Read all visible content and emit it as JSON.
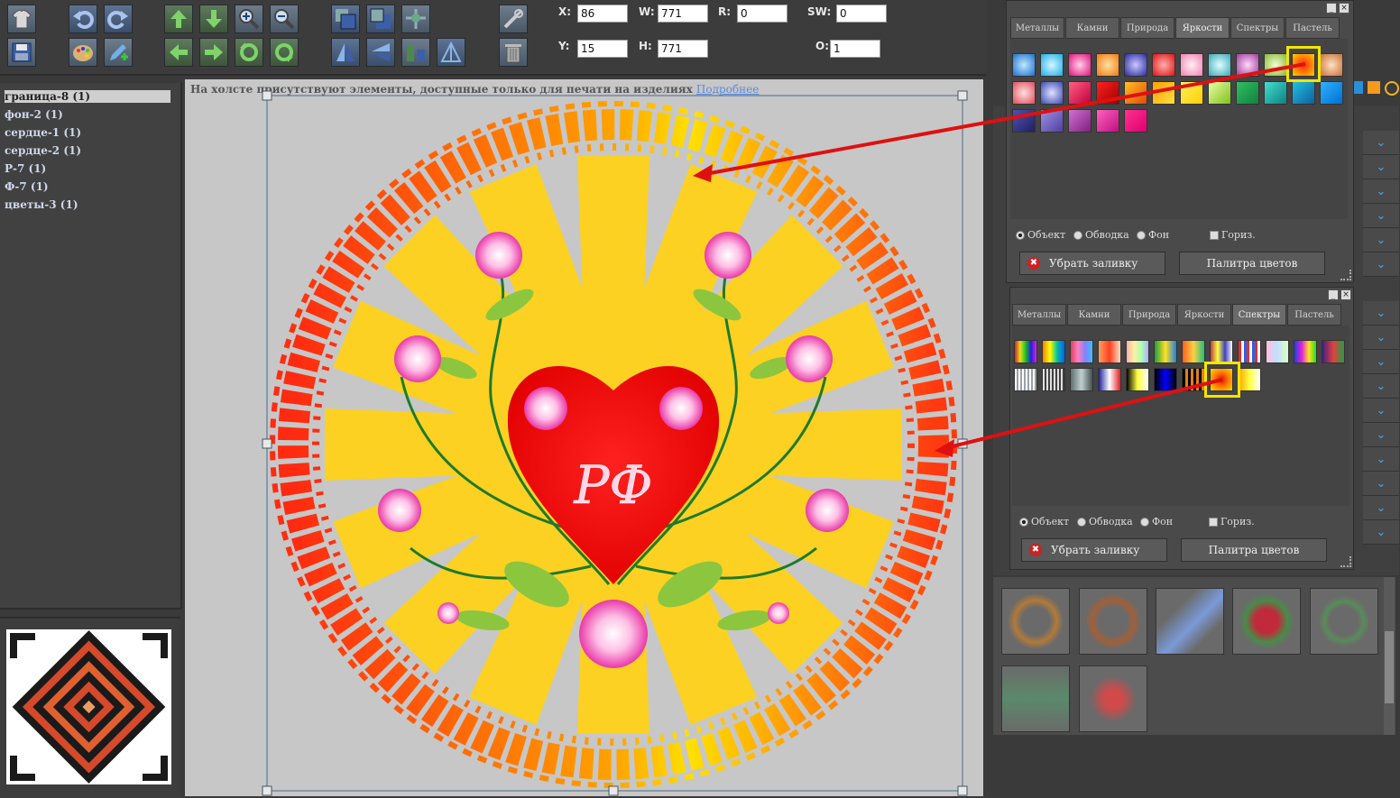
{
  "toolbar": {
    "coords": {
      "x_label": "X:",
      "x_value": "86",
      "y_label": "Y:",
      "y_value": "15",
      "w_label": "W:",
      "w_value": "771",
      "h_label": "H:",
      "h_value": "771",
      "r_label": "R:",
      "r_value": "0",
      "sw_label": "SW:",
      "sw_value": "0",
      "o_label": "O:",
      "o_value": "1"
    },
    "icons": [
      "tshirt-icon",
      "save-icon",
      "undo-icon",
      "redo-icon",
      "palette-icon",
      "edit-add-icon",
      "move-up-icon",
      "move-down-icon",
      "zoom-in-icon",
      "zoom-out-icon",
      "move-left-icon",
      "move-right-icon",
      "rotate-left-icon",
      "rotate-right-icon",
      "bring-front-icon",
      "send-back-icon",
      "group-icon",
      "flip-horizontal-icon",
      "flip-vertical-icon",
      "align-icon",
      "align-bottom-icon",
      "tools-icon",
      "trash-icon"
    ]
  },
  "layers": [
    {
      "label": "граница-8 (1)",
      "active": true
    },
    {
      "label": "фон-2 (1)"
    },
    {
      "label": "сердце-1 (1)"
    },
    {
      "label": "сердце-2 (1)"
    },
    {
      "label": "Р-7 (1)"
    },
    {
      "label": "Ф-7 (1)"
    },
    {
      "label": "цветы-3 (1)"
    }
  ],
  "canvas": {
    "notice": "На холсте присутствуют элементы, доступные только для печати на изделиях",
    "notice_link": "Подробнее",
    "monogram": "РФ"
  },
  "fill_panel_1": {
    "tabs": [
      "Металлы",
      "Камни",
      "Природа",
      "Яркости",
      "Спектры",
      "Пастель"
    ],
    "active_tab": "Яркости",
    "radio_object": "Объект",
    "radio_stroke": "Обводка",
    "radio_bg": "Фон",
    "check_horiz": "Гориз.",
    "remove_fill": "Убрать заливку",
    "palette": "Палитра цветов"
  },
  "fill_panel_2": {
    "tabs": [
      "Металлы",
      "Камни",
      "Природа",
      "Яркости",
      "Спектры",
      "Пастель"
    ],
    "active_tab": "Спектры",
    "radio_object": "Объект",
    "radio_stroke": "Обводка",
    "radio_bg": "Фон",
    "check_horiz": "Гориз.",
    "remove_fill": "Убрать заливку",
    "palette": "Палитра цветов"
  },
  "colors": {
    "highlight": "#f2e600",
    "arrow": "#e01010",
    "link": "#5a8be0"
  }
}
